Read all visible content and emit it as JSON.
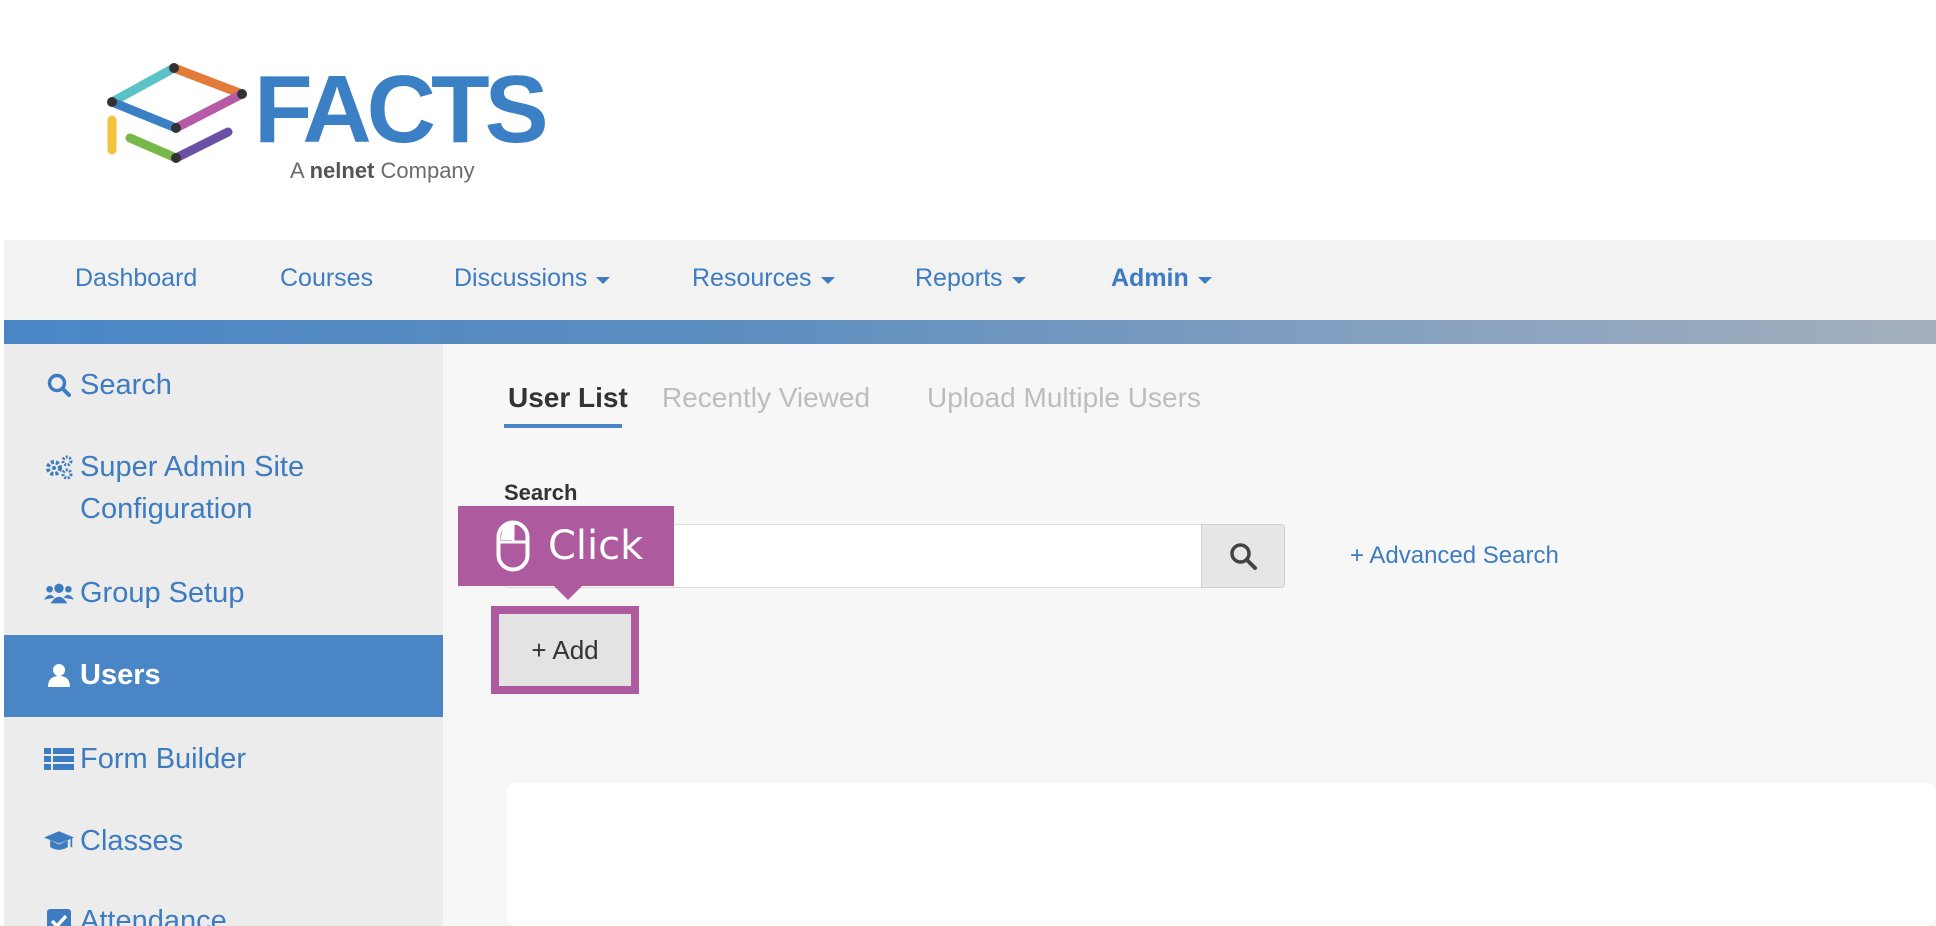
{
  "logo": {
    "word": "FACTS",
    "sub_prefix": "A",
    "sub_brand": "nelnet",
    "sub_suffix": "Company"
  },
  "topnav": {
    "items": [
      {
        "label": "Dashboard"
      },
      {
        "label": "Courses"
      },
      {
        "label": "Discussions"
      },
      {
        "label": "Resources"
      },
      {
        "label": "Reports"
      },
      {
        "label": "Admin"
      }
    ]
  },
  "sidebar": {
    "items": [
      {
        "label": "Search",
        "icon": "search-icon"
      },
      {
        "label": "Super Admin Site Configuration",
        "icon": "gears-icon"
      },
      {
        "label": "Group Setup",
        "icon": "users-group-icon"
      },
      {
        "label": "Users",
        "icon": "user-icon",
        "active": true
      },
      {
        "label": "Form Builder",
        "icon": "list-icon"
      },
      {
        "label": "Classes",
        "icon": "graduation-cap-icon"
      },
      {
        "label": "Attendance",
        "icon": "checkbox-icon"
      }
    ]
  },
  "main": {
    "tabs": [
      {
        "label": "User List",
        "active": true
      },
      {
        "label": "Recently Viewed"
      },
      {
        "label": "Upload Multiple Users"
      }
    ],
    "search_label": "Search",
    "search_value": "",
    "advanced_search": "+ Advanced Search",
    "add_button": "+ Add"
  },
  "callout": {
    "label": "Click",
    "icon": "mouse-icon"
  },
  "colors": {
    "brand_blue": "#3d7cc0",
    "active_blue": "#4a86c6",
    "highlight_purple": "#ad5a9f"
  }
}
